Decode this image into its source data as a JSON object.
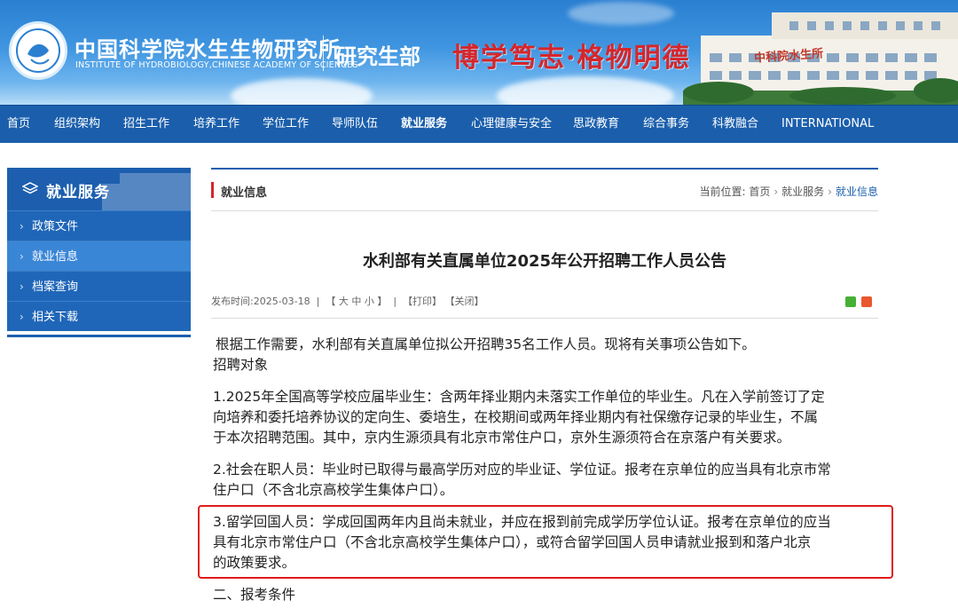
{
  "header": {
    "institute_cn": "中国科学院水生生物研究所",
    "institute_en": "INSTITUTE OF HYDROBIOLOGY,CHINESE ACADEMY OF SCIENCES",
    "department": "研究生部",
    "motto": "博学笃志·格物明德",
    "building_sign": "中科院水生所"
  },
  "nav": {
    "items": [
      "首页",
      "组织架构",
      "招生工作",
      "培养工作",
      "学位工作",
      "导师队伍",
      "就业服务",
      "心理健康与安全",
      "思政教育",
      "综合事务",
      "科教融合",
      "INTERNATIONAL"
    ],
    "active": "就业服务"
  },
  "sidebar": {
    "title": "就业服务",
    "items": [
      {
        "label": "政策文件"
      },
      {
        "label": "就业信息"
      },
      {
        "label": "档案查询"
      },
      {
        "label": "相关下载"
      }
    ]
  },
  "section": {
    "title": "就业信息",
    "breadcrumb_label": "当前位置:",
    "breadcrumb": [
      "首页",
      "就业服务",
      "就业信息"
    ]
  },
  "article": {
    "title": "水利部有关直属单位2025年公开招聘工作人员公告",
    "meta": {
      "date_label": "发布时间:",
      "date": "2025-03-18",
      "size_label": "【 大  中  小 】",
      "print": "【打印】",
      "close": "【关闭】"
    },
    "paragraphs": {
      "intro": "根据工作需要，水利部有关直属单位拟公开招聘35名工作人员。现将有关事项公告如下。",
      "heading1": "招聘对象",
      "p1_l1": "1.2025年全国高等学校应届毕业生：含两年择业期内未落实工作单位的毕业生。凡在入学前签订了定",
      "p1_l2": "向培养和委托培养协议的定向生、委培生，在校期间或两年择业期内有社保缴存记录的毕业生，不属",
      "p1_l3": "于本次招聘范围。其中，京内生源须具有北京市常住户口，京外生源须符合在京落户有关要求。",
      "p2_l1": "2.社会在职人员：毕业时已取得与最高学历对应的毕业证、学位证。报考在京单位的应当具有北京市常",
      "p2_l2": "住户口（不含北京高校学生集体户口）。",
      "p3_l1": "3.留学回国人员：学成回国两年内且尚未就业，并应在报到前完成学历学位认证。报考在京单位的应当",
      "p3_l2": "具有北京市常住户口（不含北京高校学生集体户口），或符合留学回国人员申请就业报到和落户北京",
      "p3_l3": "的政策要求。",
      "heading2": "二、报考条件"
    }
  },
  "colors": {
    "nav_bg": "#1b5fac",
    "sidebar_active": "#3a86d6",
    "accent_red": "#d6262b",
    "highlight_border": "#e11b1b"
  }
}
